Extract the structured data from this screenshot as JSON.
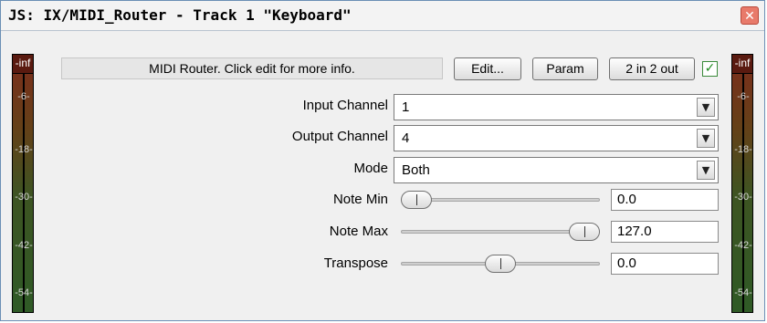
{
  "window": {
    "title": "JS: IX/MIDI_Router - Track 1 \"Keyboard\"",
    "close_glyph": "✕"
  },
  "meters": {
    "left": {
      "top": "-inf",
      "marks": [
        "-6-",
        "-18-",
        "-30-",
        "-42-",
        "-54-"
      ]
    },
    "right": {
      "top": "-inf",
      "marks": [
        "-6-",
        "-18-",
        "-30-",
        "-42-",
        "-54-"
      ]
    }
  },
  "toolbar": {
    "description": "MIDI Router. Click edit for more info.",
    "edit_label": "Edit...",
    "param_label": "Param",
    "io_label": "2 in 2 out",
    "enabled_check": "✓"
  },
  "params": {
    "input_channel": {
      "label": "Input Channel",
      "value": "1"
    },
    "output_channel": {
      "label": "Output Channel",
      "value": "4"
    },
    "mode": {
      "label": "Mode",
      "value": "Both"
    },
    "note_min": {
      "label": "Note Min",
      "value": "0.0",
      "fraction": 0.0
    },
    "note_max": {
      "label": "Note Max",
      "value": "127.0",
      "fraction": 1.0
    },
    "transpose": {
      "label": "Transpose",
      "value": "0.0",
      "fraction": 0.5
    }
  },
  "icons": {
    "dropdown": "chevron-down-icon",
    "close": "close-icon",
    "check": "checkmark-icon"
  },
  "colors": {
    "close_bg": "#e87a6a",
    "check": "#1f8a1f",
    "meter_top": "#7c2c1c",
    "meter_bottom": "#2f5a26"
  }
}
